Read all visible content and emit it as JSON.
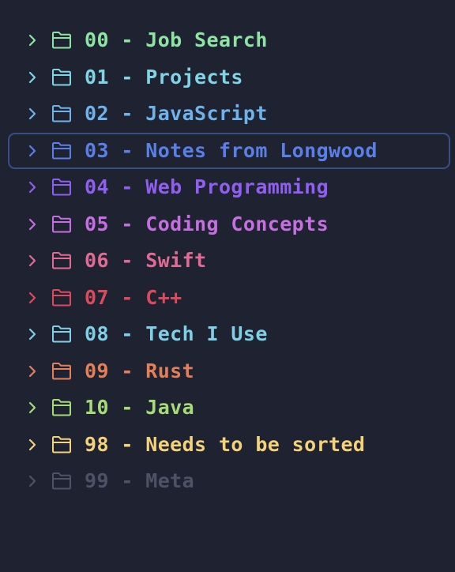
{
  "folders": [
    {
      "label": "00 - Job Search",
      "color": "#8ee4a3",
      "chevron": "#8ee4a3"
    },
    {
      "label": "01 - Projects",
      "color": "#7fd4e6",
      "chevron": "#7fd4e6"
    },
    {
      "label": "02 - JavaScript",
      "color": "#6fb3ea",
      "chevron": "#6fb3ea"
    },
    {
      "label": "03 - Notes from Longwood",
      "color": "#5a7fe6",
      "chevron": "#5a7fe6",
      "selected": true
    },
    {
      "label": "04 - Web Programming",
      "color": "#8f5ff0",
      "chevron": "#8f5ff0"
    },
    {
      "label": "05 - Coding Concepts",
      "color": "#c56fe0",
      "chevron": "#c56fe0"
    },
    {
      "label": "06 - Swift",
      "color": "#e06b94",
      "chevron": "#e06b94"
    },
    {
      "label": "07 - C++",
      "color": "#dd4a5d",
      "chevron": "#dd4a5d"
    },
    {
      "label": "08 - Tech I Use",
      "color": "#7fd0e6",
      "chevron": "#7fd0e6"
    },
    {
      "label": "09 - Rust",
      "color": "#e3805a",
      "chevron": "#e3805a"
    },
    {
      "label": "10 - Java",
      "color": "#a6dc78",
      "chevron": "#a6dc78"
    },
    {
      "label": "98 - Needs to be sorted",
      "color": "#f3d27a",
      "chevron": "#f3d27a"
    },
    {
      "label": "99 - Meta",
      "color": "#4e5264",
      "chevron": "#4e5264"
    }
  ],
  "icons": {
    "expand": "chevron-right-icon",
    "folder": "folder-icon"
  }
}
